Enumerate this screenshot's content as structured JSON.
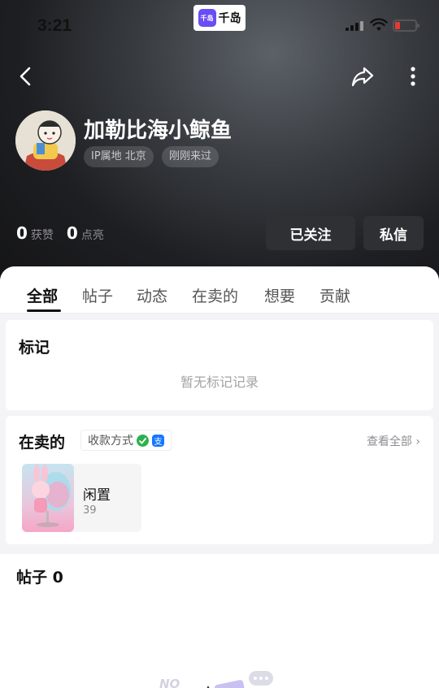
{
  "status_bar": {
    "time": "3:21",
    "app_badge": {
      "icon_text": "千岛",
      "name": "千岛"
    },
    "battery_color": "#e53935"
  },
  "profile": {
    "username": "加勒比海小鲸鱼",
    "ip_tag": "IP属地 北京",
    "visit_tag": "刚刚来过",
    "avatar_icon": "cartoon-avatar"
  },
  "stats": [
    {
      "value": "0",
      "label": "获赞"
    },
    {
      "value": "0",
      "label": "点亮"
    }
  ],
  "actions": {
    "follow": "已关注",
    "message": "私信"
  },
  "tabs": [
    {
      "label": "全部",
      "active": true
    },
    {
      "label": "帖子",
      "active": false
    },
    {
      "label": "动态",
      "active": false
    },
    {
      "label": "在卖的",
      "active": false
    },
    {
      "label": "想要",
      "active": false
    },
    {
      "label": "贡献",
      "active": false
    }
  ],
  "marks": {
    "title": "标记",
    "empty": "暂无标记记录"
  },
  "selling": {
    "title": "在卖的",
    "payment_label": "收款方式",
    "payment_icons": [
      "wechat-pay-icon",
      "alipay-icon"
    ],
    "alipay_glyph": "支",
    "see_all": "查看全部",
    "item": {
      "name": "闲置",
      "count": "39"
    }
  },
  "posts": {
    "title": "帖子 0",
    "illustration_text": "NO"
  },
  "colors": {
    "accent": "#6a4df4",
    "dark_button": "#2f3033",
    "wechat": "#2bb24c",
    "alipay": "#1677ff"
  }
}
